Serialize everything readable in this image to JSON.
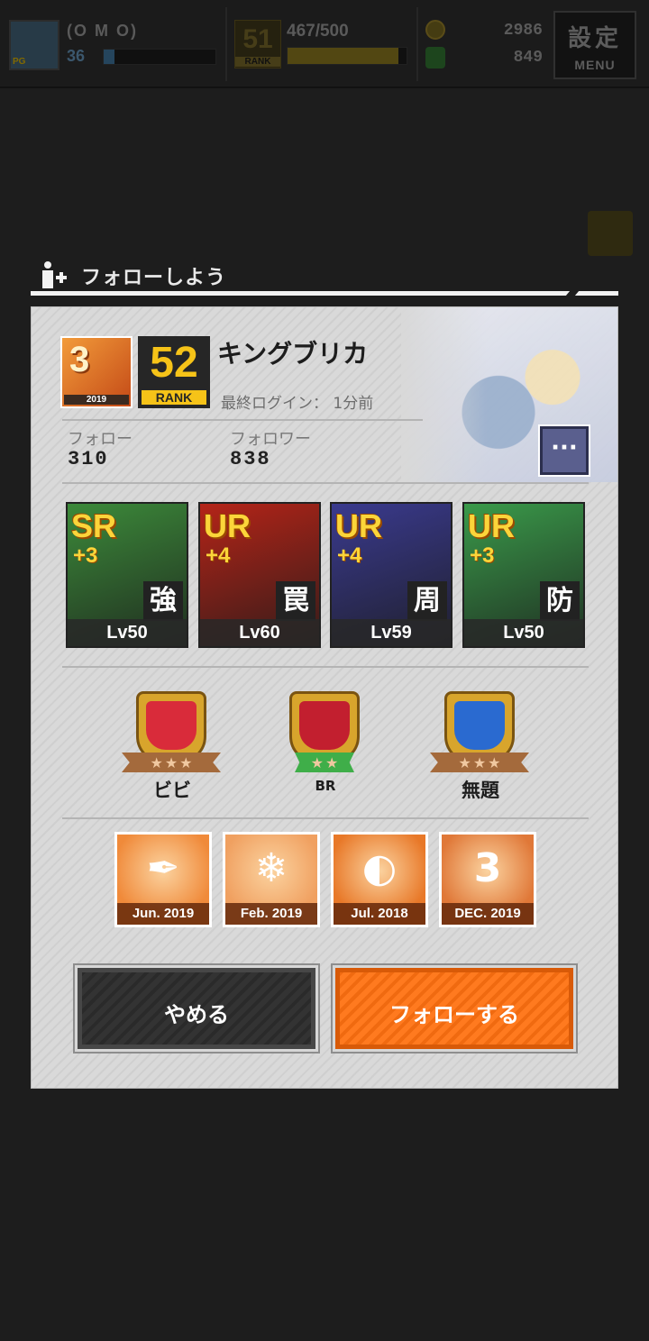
{
  "topbar": {
    "player_name": "(O M O)",
    "player_level": "36",
    "exp_fraction": 0.1,
    "rank": "51",
    "rank_label": "RANK",
    "stamina": "467/500",
    "stamina_fraction": 0.93,
    "coins": "2986",
    "gems": "849",
    "menu_kanji": "設定",
    "menu_label": "MENU"
  },
  "dialog": {
    "title": "フォローしよう",
    "profile": {
      "badge_big": "3",
      "badge_small": "2019",
      "rank": "52",
      "rank_label": "RANK",
      "name": "キングブリカ",
      "last_login": "最終ログイン： 1分前",
      "follow_label": "フォロー",
      "follow_count": "310",
      "follower_label": "フォロワー",
      "follower_count": "838",
      "more_label": "···"
    },
    "cards": [
      {
        "rarity": "SR",
        "plus": "+3",
        "role": "強",
        "level": "Lv50",
        "bg": "#3c8a3a"
      },
      {
        "rarity": "UR",
        "plus": "+4",
        "role": "罠",
        "level": "Lv60",
        "bg": "#b42418"
      },
      {
        "rarity": "UR",
        "plus": "+4",
        "role": "周",
        "level": "Lv59",
        "bg": "#3a3a8e"
      },
      {
        "rarity": "UR",
        "plus": "+3",
        "role": "防",
        "level": "Lv50",
        "bg": "#3a9a4a"
      }
    ],
    "guilds": [
      {
        "name": "ビビ",
        "stars": "★★★",
        "inner": "#d92b3a"
      },
      {
        "name": "BR",
        "stars": "★★",
        "inner": "#c21f2f"
      },
      {
        "name": "無題",
        "stars": "★★★",
        "inner": "#2a6ad0"
      }
    ],
    "achievements": [
      {
        "caption": "Jun. 2019",
        "glyph": "✒",
        "bg": "#f08a3a"
      },
      {
        "caption": "Feb. 2019",
        "glyph": "❄",
        "bg": "#f0a060"
      },
      {
        "caption": "Jul. 2018",
        "glyph": "◐",
        "bg": "#e87828"
      },
      {
        "caption": "DEC. 2019",
        "glyph": "3",
        "bg": "#e07838"
      }
    ],
    "buttons": {
      "cancel": "やめる",
      "follow": "フォローする"
    }
  }
}
